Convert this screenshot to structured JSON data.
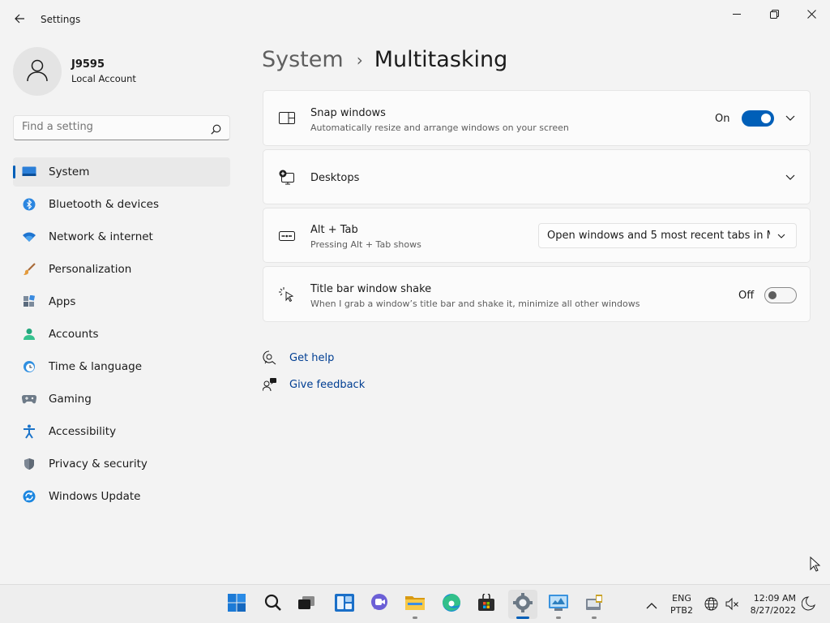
{
  "window": {
    "title": "Settings",
    "back_icon": "back-arrow-icon",
    "controls": [
      "minimize-icon",
      "restore-icon",
      "close-icon"
    ]
  },
  "profile": {
    "name": "J9595",
    "account_type": "Local Account"
  },
  "search": {
    "placeholder": "Find a setting"
  },
  "sidebar": {
    "items": [
      {
        "label": "System",
        "icon": "system-icon",
        "selected": true
      },
      {
        "label": "Bluetooth & devices",
        "icon": "bluetooth-icon"
      },
      {
        "label": "Network & internet",
        "icon": "wifi-icon"
      },
      {
        "label": "Personalization",
        "icon": "brush-icon"
      },
      {
        "label": "Apps",
        "icon": "apps-icon"
      },
      {
        "label": "Accounts",
        "icon": "accounts-icon"
      },
      {
        "label": "Time & language",
        "icon": "clock-globe-icon"
      },
      {
        "label": "Gaming",
        "icon": "gamepad-icon"
      },
      {
        "label": "Accessibility",
        "icon": "accessibility-icon"
      },
      {
        "label": "Privacy & security",
        "icon": "shield-icon"
      },
      {
        "label": "Windows Update",
        "icon": "update-icon"
      }
    ]
  },
  "breadcrumb": {
    "parent": "System",
    "separator": "›",
    "current": "Multitasking"
  },
  "settings": {
    "snap": {
      "title": "Snap windows",
      "description": "Automatically resize and arrange windows on your screen",
      "state_label": "On",
      "enabled": true,
      "icon": "snap-windows-icon"
    },
    "desktops": {
      "title": "Desktops",
      "icon": "desktops-icon"
    },
    "alt_tab": {
      "title": "Alt + Tab",
      "description": "Pressing Alt + Tab shows",
      "selected_option": "Open windows and 5 most recent tabs in M",
      "icon": "alt-tab-icon"
    },
    "shake": {
      "title": "Title bar window shake",
      "description": "When I grab a window’s title bar and shake it, minimize all other windows",
      "state_label": "Off",
      "enabled": false,
      "icon": "shake-icon"
    }
  },
  "links": {
    "help": "Get help",
    "feedback": "Give feedback"
  },
  "taskbar": {
    "apps": [
      "start-icon",
      "search-icon",
      "task-view-icon",
      "widgets-icon",
      "chat-icon",
      "file-explorer-icon",
      "edge-icon",
      "store-icon",
      "settings-icon",
      "control-panel-icon",
      "device-manager-icon"
    ],
    "language_line1": "ENG",
    "language_line2": "PTB2",
    "time": "12:09 AM",
    "date": "8/27/2022"
  },
  "colors": {
    "accent": "#005fb8",
    "background": "#f3f3f3",
    "card": "#fbfbfb",
    "link": "#003e92"
  }
}
